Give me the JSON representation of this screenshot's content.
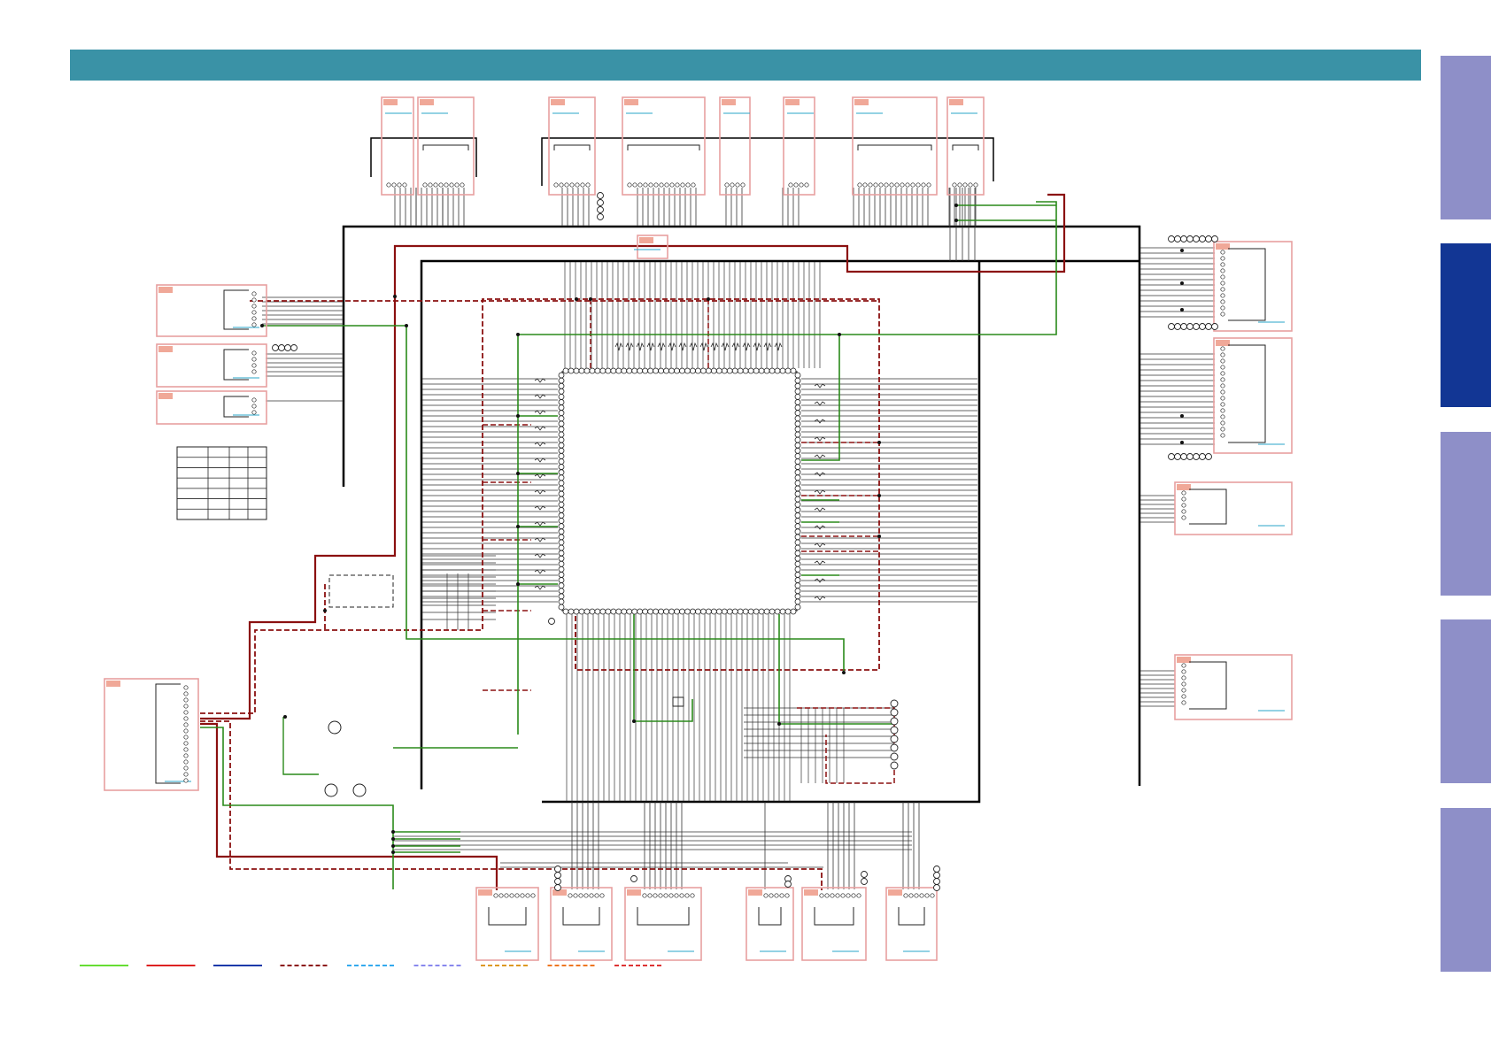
{
  "header": {
    "color": "#3a92a6"
  },
  "side_tabs": [
    {
      "active": false,
      "color": "#8e8fc8"
    },
    {
      "active": true,
      "color": "#123694"
    },
    {
      "active": false,
      "color": "#8e8fc8"
    },
    {
      "active": false,
      "color": "#8e8fc8"
    },
    {
      "active": false,
      "color": "#8e8fc8"
    }
  ],
  "colors": {
    "block_border": "#e8a0a0",
    "block_tag": "#f0a898",
    "block_link": "#2aa6c8",
    "bus": "#000000",
    "power_red": "#8b1010",
    "signal_green": "#2a8a1a",
    "wire": "#333333"
  },
  "legend": [
    {
      "color": "#66dd33",
      "style": "solid"
    },
    {
      "color": "#dd2222",
      "style": "solid"
    },
    {
      "color": "#1a3aaa",
      "style": "solid"
    },
    {
      "color": "#8b1010",
      "style": "dashed"
    },
    {
      "color": "#33aaee",
      "style": "dashed"
    },
    {
      "color": "#8888ee",
      "style": "dashed"
    },
    {
      "color": "#dd9922",
      "style": "dashed"
    },
    {
      "color": "#ee7722",
      "style": "dashed"
    },
    {
      "color": "#dd3333",
      "style": "dashed"
    }
  ]
}
